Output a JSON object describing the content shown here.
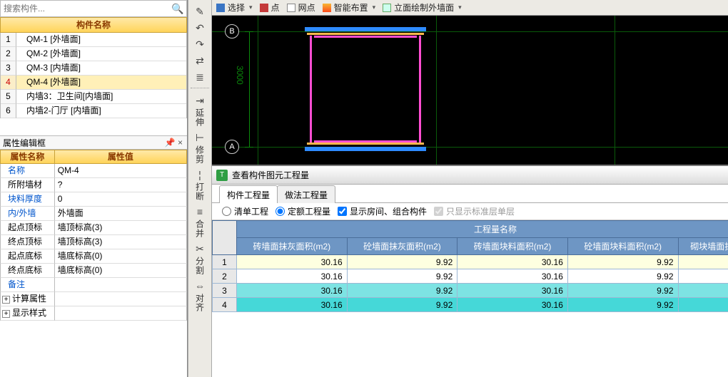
{
  "search": {
    "placeholder": "搜索构件..."
  },
  "components": {
    "header": "构件名称",
    "rows": [
      {
        "n": "1",
        "v": "QM-1 [外墙面]"
      },
      {
        "n": "2",
        "v": "QM-2 [外墙面]"
      },
      {
        "n": "3",
        "v": "QM-3 [内墙面]"
      },
      {
        "n": "4",
        "v": "QM-4 [外墙面]",
        "sel": true
      },
      {
        "n": "5",
        "v": "内墙3：卫生间[内墙面]"
      },
      {
        "n": "6",
        "v": "内墙2-门厅 [内墙面]"
      }
    ]
  },
  "props_panel": {
    "title": "属性编辑框",
    "h1": "属性名称",
    "h2": "属性值"
  },
  "props": [
    {
      "k": "名称",
      "v": "QM-4",
      "blue": true
    },
    {
      "k": "所附墙材",
      "v": "?"
    },
    {
      "k": "块料厚度",
      "v": "0",
      "blue": true
    },
    {
      "k": "内/外墙",
      "v": "外墙面",
      "blue": true
    },
    {
      "k": "起点顶标",
      "v": "墙顶标高(3)"
    },
    {
      "k": "终点顶标",
      "v": "墙顶标高(3)"
    },
    {
      "k": "起点底标",
      "v": "墙底标高(0)"
    },
    {
      "k": "终点底标",
      "v": "墙底标高(0)"
    },
    {
      "k": "备注",
      "v": "",
      "blue": true
    }
  ],
  "prop_trees": {
    "a": "计算属性",
    "b": "显示样式"
  },
  "vtool_labels": {
    "a": "延伸",
    "b": "修剪",
    "c": "打断",
    "d": "合并",
    "e": "分割",
    "f": "对齐"
  },
  "top_toolbar": {
    "a": "选择",
    "b": "点",
    "c": "网点",
    "d": "智能布置",
    "e": "立面绘制外墙面"
  },
  "canvas": {
    "axisA": "A",
    "axisB": "B",
    "dim": "3000"
  },
  "qty": {
    "title": "查看构件图元工程量",
    "tab1": "构件工程量",
    "tab2": "做法工程量",
    "opt_list": "清单工程",
    "opt_quota": "定额工程量",
    "chk_room": "显示房间、组合构件",
    "chk_std": "只显示标准层单层",
    "grp_header": "工程量名称",
    "cols": [
      "砖墙面抹灰面积(m2)",
      "砼墙面抹灰面积(m2)",
      "砖墙面块料面积(m2)",
      "砼墙面块料面积(m2)",
      "砌块墙面抹灰"
    ]
  },
  "chart_data": {
    "type": "table",
    "title": "工程量名称",
    "columns": [
      "砖墙面抹灰面积(m2)",
      "砼墙面抹灰面积(m2)",
      "砖墙面块料面积(m2)",
      "砼墙面块料面积(m2)"
    ],
    "rows": [
      {
        "n": 1,
        "values": [
          30.16,
          9.92,
          30.16,
          9.92
        ]
      },
      {
        "n": 2,
        "values": [
          30.16,
          9.92,
          30.16,
          9.92
        ]
      },
      {
        "n": 3,
        "values": [
          30.16,
          9.92,
          30.16,
          9.92
        ]
      },
      {
        "n": 4,
        "values": [
          30.16,
          9.92,
          30.16,
          9.92
        ]
      }
    ]
  }
}
